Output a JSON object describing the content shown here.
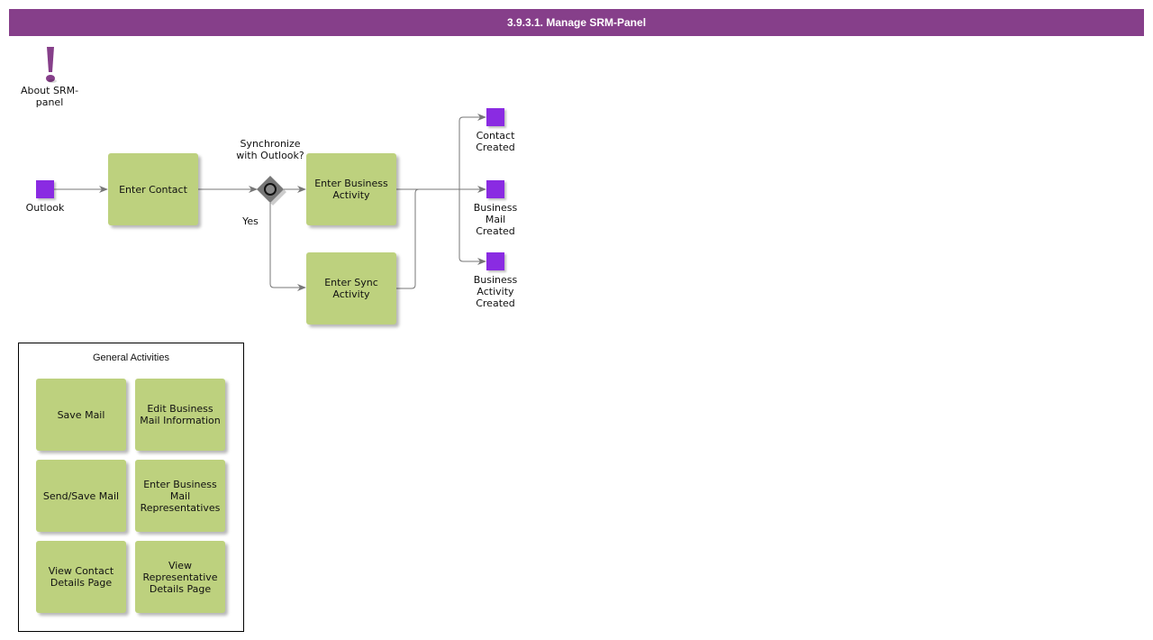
{
  "title": "3.9.3.1. Manage SRM-Panel",
  "colors": {
    "title_bar": "#863f8a",
    "task_fill": "#bdd17e",
    "event_fill": "#8a2be2",
    "gateway_fill": "#777777",
    "connector": "#777777"
  },
  "about": {
    "icon": "exclamation-icon",
    "label": "About SRM-panel"
  },
  "start_event": {
    "label": "Outlook"
  },
  "tasks": {
    "enter_contact": "Enter Contact",
    "enter_business_activity": "Enter Business Activity",
    "enter_sync_activity": "Enter Sync Activity"
  },
  "gateway": {
    "label": "Synchronize with Outlook?",
    "yes_label": "Yes"
  },
  "end_events": [
    {
      "label": "Contact Created"
    },
    {
      "label": "Business Mail Created"
    },
    {
      "label": "Business Activity Created"
    }
  ],
  "general_activities": {
    "title": "General Activities",
    "items": [
      "Save Mail",
      "Edit Business Mail Information",
      "Send/Save Mail",
      "Enter Business Mail Representatives",
      "View Contact Details Page",
      "View Representative Details Page"
    ]
  }
}
